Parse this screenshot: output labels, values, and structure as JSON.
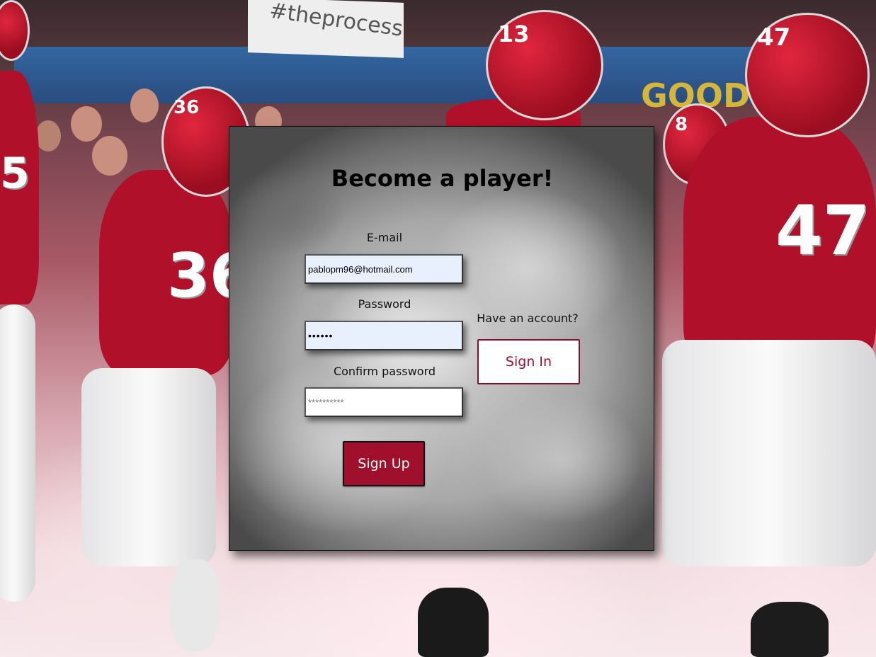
{
  "background": {
    "banner_text": "#theprocess",
    "sign_text": "GOOD",
    "jersey_numbers": [
      "36",
      "13",
      "47",
      "8",
      "5"
    ]
  },
  "form": {
    "title": "Become a player!",
    "email": {
      "label": "E-mail",
      "value": "pablopm96@hotmail.com"
    },
    "password": {
      "label": "Password",
      "value": "••••••"
    },
    "confirm_password": {
      "label": "Confirm password",
      "placeholder": "**********"
    },
    "signup_label": "Sign Up",
    "account_prompt": "Have an account?",
    "signin_label": "Sign In"
  },
  "colors": {
    "primary_crimson": "#a0102c",
    "autofill_blue": "#e8f0fe"
  }
}
